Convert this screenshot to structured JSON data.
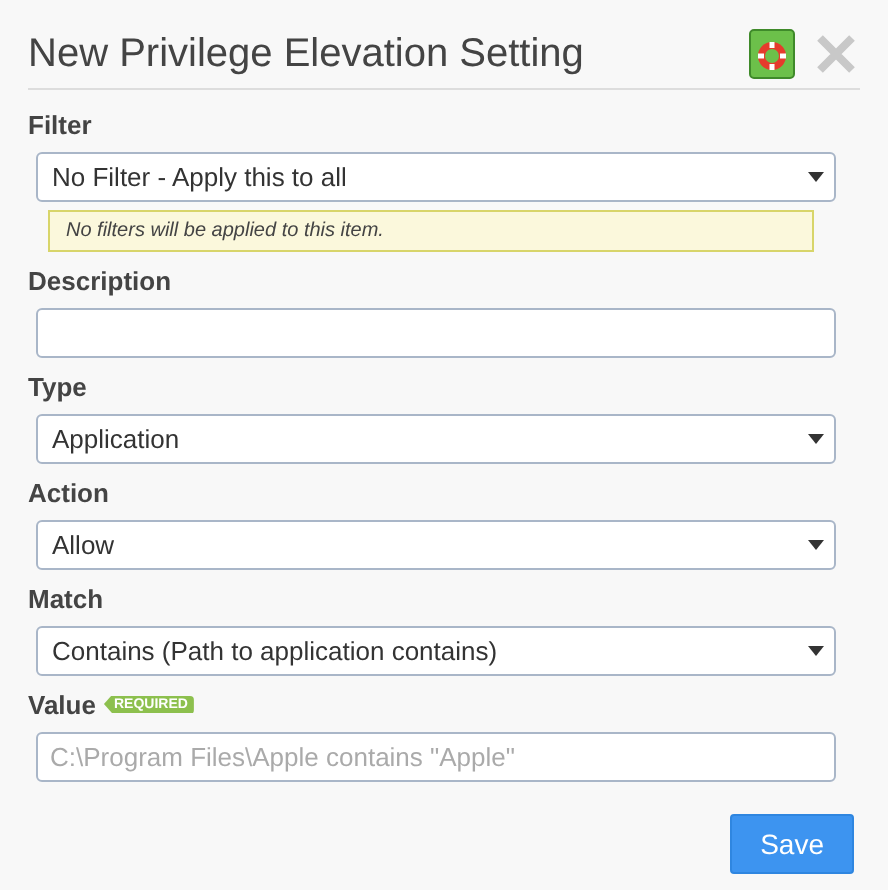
{
  "dialog": {
    "title": "New Privilege Elevation Setting"
  },
  "fields": [
    {
      "label": "Filter",
      "kind": "select",
      "value": "No Filter - Apply this to all",
      "note": "No filters will be applied to this item."
    },
    {
      "label": "Description",
      "kind": "text"
    },
    {
      "label": "Type",
      "kind": "select",
      "value": "Application"
    },
    {
      "label": "Action",
      "kind": "select",
      "value": "Allow"
    },
    {
      "label": "Match",
      "kind": "select",
      "value": "Contains (Path to application contains)"
    },
    {
      "label": "Value",
      "kind": "text",
      "badge": "REQUIRED",
      "placeholder": "C:\\Program Files\\Apple contains \"Apple\""
    }
  ],
  "buttons": [
    "Save"
  ]
}
